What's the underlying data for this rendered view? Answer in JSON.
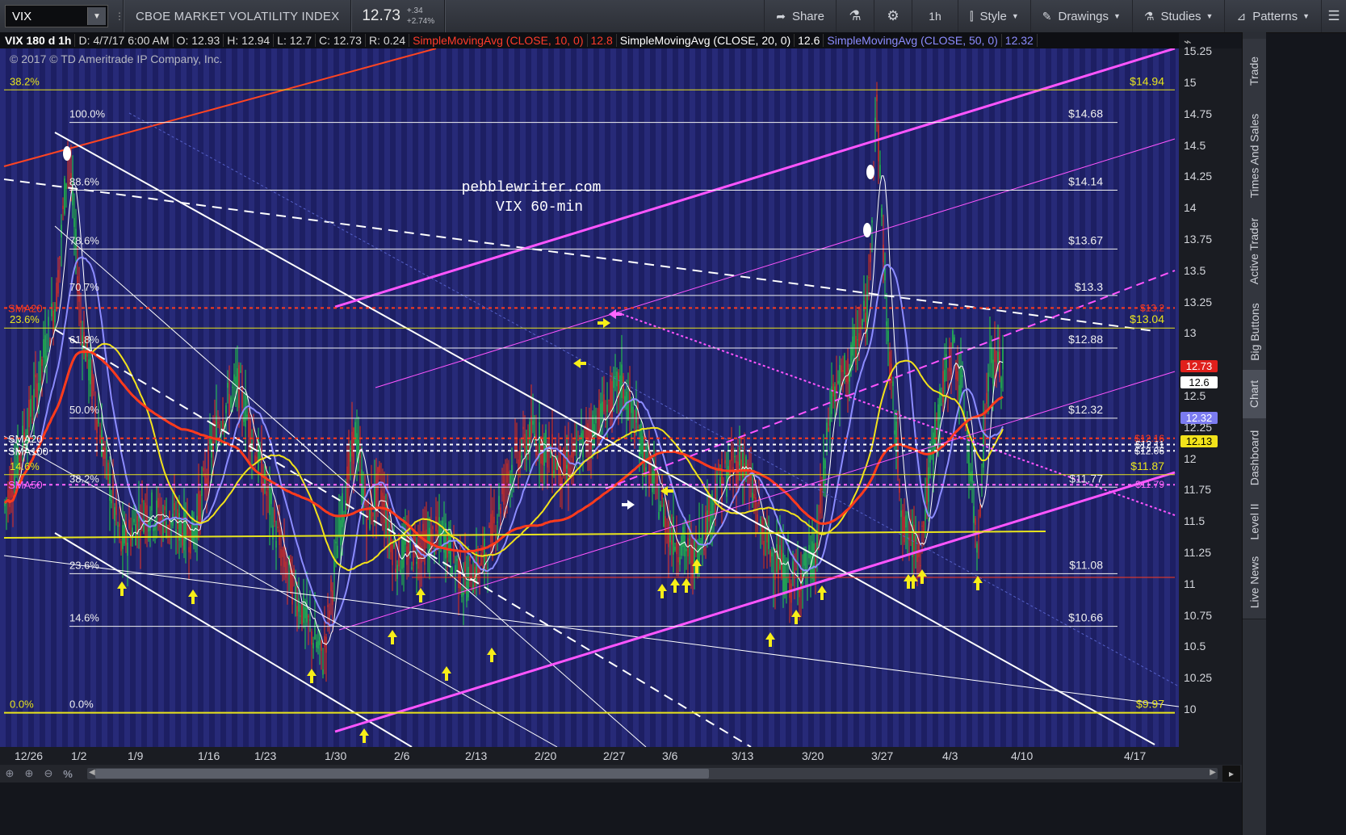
{
  "toolbar": {
    "symbol": "VIX",
    "description": "CBOE MARKET VOLATILITY INDEX",
    "last_price": "12.73",
    "net_change": "+.34",
    "pct_change": "+2.74%",
    "share": "Share",
    "timeframe": "1h",
    "style": "Style",
    "drawings": "Drawings",
    "studies": "Studies",
    "patterns": "Patterns"
  },
  "infobar": {
    "head": "VIX 180 d 1h",
    "date": "D: 4/7/17 6:00 AM",
    "open": "O: 12.93",
    "high": "H: 12.94",
    "low": "L: 12.7",
    "close": "C: 12.73",
    "range": "R: 0.24",
    "sma10_label": "SimpleMovingAvg (CLOSE, 10, 0)",
    "sma10_value": "12.8",
    "sma20_label": "SimpleMovingAvg (CLOSE, 20, 0)",
    "sma20_value": "12.6",
    "sma50_label": "SimpleMovingAvg (CLOSE, 50, 0)",
    "sma50_value": "12.32"
  },
  "chart": {
    "copyright": "© 2017 © TD Ameritrade IP Company, Inc.",
    "watermark_line1": "pebblewriter.com",
    "watermark_line2": "VIX 60-min",
    "sma_labels": [
      "SMA20",
      "SMA20",
      "SMA100",
      "SMA50"
    ],
    "fib_levels": [
      {
        "left": "38.2%",
        "label": "",
        "value": "$14.94",
        "price": 14.94
      },
      {
        "left": "",
        "label": "100.0%",
        "value": "$14.68",
        "price": 14.68
      },
      {
        "left": "",
        "label": "88.6%",
        "value": "$14.14",
        "price": 14.14
      },
      {
        "left": "",
        "label": "78.6%",
        "value": "$13.67",
        "price": 13.67
      },
      {
        "left": "",
        "label": "70.7%",
        "value": "$13.3",
        "price": 13.3
      },
      {
        "left": "23.6%",
        "label": "",
        "value": "$13.04",
        "price": 13.04
      },
      {
        "left": "",
        "label": "61.8%",
        "value": "$12.88",
        "price": 12.88
      },
      {
        "left": "",
        "label": "50.0%",
        "value": "$12.32",
        "price": 12.32
      },
      {
        "left": "14.6%",
        "label": "",
        "value": "$11.87",
        "price": 11.87
      },
      {
        "left": "",
        "label": "38.2%",
        "value": "$11.77",
        "price": 11.77
      },
      {
        "left": "",
        "label": "23.6%",
        "value": "$11.08",
        "price": 11.08
      },
      {
        "left": "",
        "label": "14.6%",
        "value": "$10.66",
        "price": 10.66
      },
      {
        "left": "0.0%",
        "label": "0.0%",
        "value": "$9.97",
        "price": 9.97
      }
    ],
    "extra_values": [
      "$13.2",
      "$12.16",
      "$12.11",
      "$12.06",
      "$11.79"
    ]
  },
  "price_axis": {
    "ticks": [
      "15.25",
      "15",
      "14.75",
      "14.5",
      "14.25",
      "14",
      "13.75",
      "13.5",
      "13.25",
      "13",
      "12.5",
      "12.25",
      "12",
      "11.75",
      "11.5",
      "11.25",
      "11",
      "10.75",
      "10.5",
      "10.25",
      "10"
    ],
    "badges": [
      {
        "text": "12.73",
        "bg": "#e0201c",
        "fg": "#ffffff"
      },
      {
        "text": "12.6",
        "bg": "#ffffff",
        "fg": "#000000"
      },
      {
        "text": "12.32",
        "bg": "#7b7bf0",
        "fg": "#ffffff"
      },
      {
        "text": "12.13",
        "bg": "#f2e21a",
        "fg": "#000000"
      }
    ]
  },
  "date_axis": {
    "ticks": [
      "12/26",
      "1/2",
      "1/9",
      "1/16",
      "1/23",
      "1/30",
      "2/6",
      "2/13",
      "2/20",
      "2/27",
      "3/6",
      "3/13",
      "3/20",
      "3/27",
      "4/3",
      "4/10",
      "4/17"
    ]
  },
  "sidebar": {
    "tabs": [
      "Trade",
      "Times And Sales",
      "Active Trader",
      "Big Buttons",
      "Chart",
      "Dashboard",
      "Level II",
      "Live News"
    ]
  },
  "colors": {
    "background": "#14161c",
    "chart_bg_a": "#1d1f63",
    "chart_bg_b": "#272a78",
    "fib_white": "#f0f0f0",
    "fib_yellow": "#e8e41c",
    "sma10": "#ff3b1c",
    "sma20": "#ffffff",
    "sma50": "#8c8cff",
    "sma_yellow": "#f2e21a",
    "channel_pink": "#ff55ff"
  }
}
